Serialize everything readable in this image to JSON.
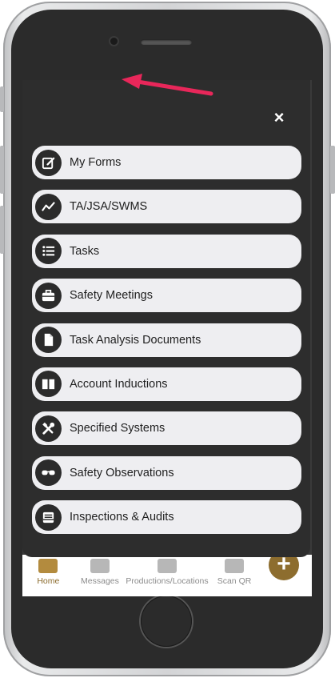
{
  "menu": {
    "close_label": "×",
    "items": [
      {
        "label": "My Forms",
        "icon": "edit-form-icon"
      },
      {
        "label": "TA/JSA/SWMS",
        "icon": "line-chart-icon"
      },
      {
        "label": "Tasks",
        "icon": "list-icon"
      },
      {
        "label": "Safety Meetings",
        "icon": "briefcase-icon"
      },
      {
        "label": "Task Analysis Documents",
        "icon": "document-icon"
      },
      {
        "label": "Account Inductions",
        "icon": "book-icon"
      },
      {
        "label": "Specified Systems",
        "icon": "tools-icon"
      },
      {
        "label": "Safety Observations",
        "icon": "glasses-icon"
      },
      {
        "label": "Inspections & Audits",
        "icon": "inbox-tray-icon"
      }
    ]
  },
  "tabbar": {
    "tabs": [
      {
        "label": "Home",
        "icon": "home-icon",
        "active": true
      },
      {
        "label": "Messages",
        "icon": "chat-icon"
      },
      {
        "label": "Productions/Locations",
        "icon": "building-icon"
      },
      {
        "label": "Scan QR",
        "icon": "qr-code-icon"
      }
    ],
    "fab_label": "+"
  },
  "colors": {
    "accent": "#8d6d2e",
    "panel": "#2d2d2d",
    "item_bg": "#eeeef1",
    "annotation_arrow": "#e8275a"
  }
}
